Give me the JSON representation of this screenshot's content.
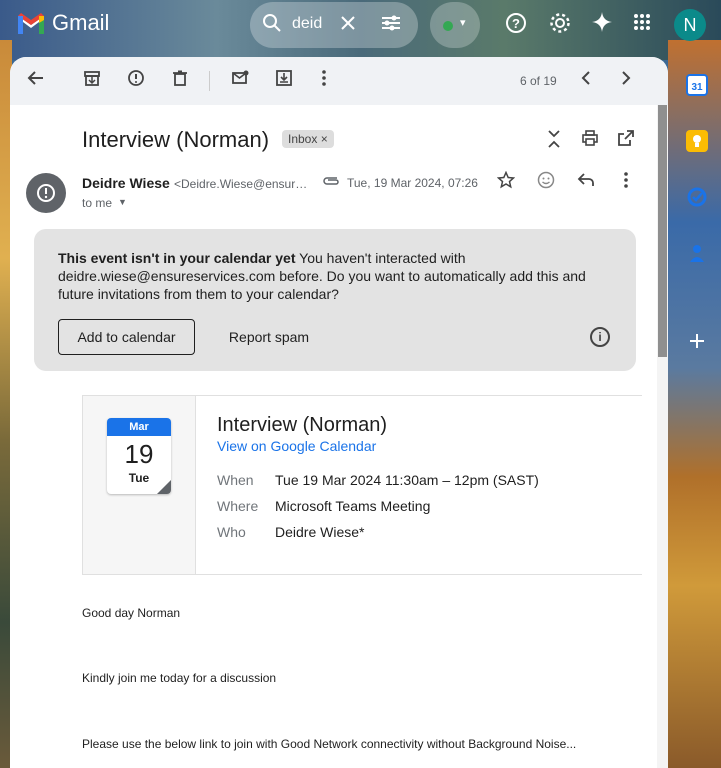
{
  "app": {
    "name": "Gmail"
  },
  "search": {
    "query": "deid"
  },
  "user": {
    "initial": "N"
  },
  "pager": {
    "text": "6 of 19"
  },
  "email": {
    "subject": "Interview (Norman)",
    "label": "Inbox",
    "sender_name": "Deidre Wiese",
    "sender_email": "<Deidre.Wiese@ensureservices.com>",
    "date": "Tue, 19 Mar 2024, 07:26",
    "to": "to me"
  },
  "notice": {
    "title": "This event isn't in your calendar yet",
    "text": " You haven't interacted with deidre.wiese@ensureservices.com before. Do you want to automatically add this and future invitations from them to your calendar?",
    "add_label": "Add to calendar",
    "spam_label": "Report spam"
  },
  "event": {
    "month": "Mar",
    "day": "19",
    "dow": "Tue",
    "title": "Interview (Norman)",
    "link": "View on Google Calendar",
    "when_label": "When",
    "when": "Tue 19 Mar 2024 11:30am – 12pm (SAST)",
    "where_label": "Where",
    "where": "Microsoft Teams Meeting",
    "who_label": "Who",
    "who": "Deidre Wiese*"
  },
  "body": {
    "line1": "Good day Norman",
    "line2": "Kindly join me today for a discussion",
    "line3": "Please use the below link to join with Good Network connectivity without Background Noise..."
  },
  "colors": {
    "accent": "#1a73e8",
    "status_green": "#34a853",
    "avatar": "#0b8a8a"
  }
}
